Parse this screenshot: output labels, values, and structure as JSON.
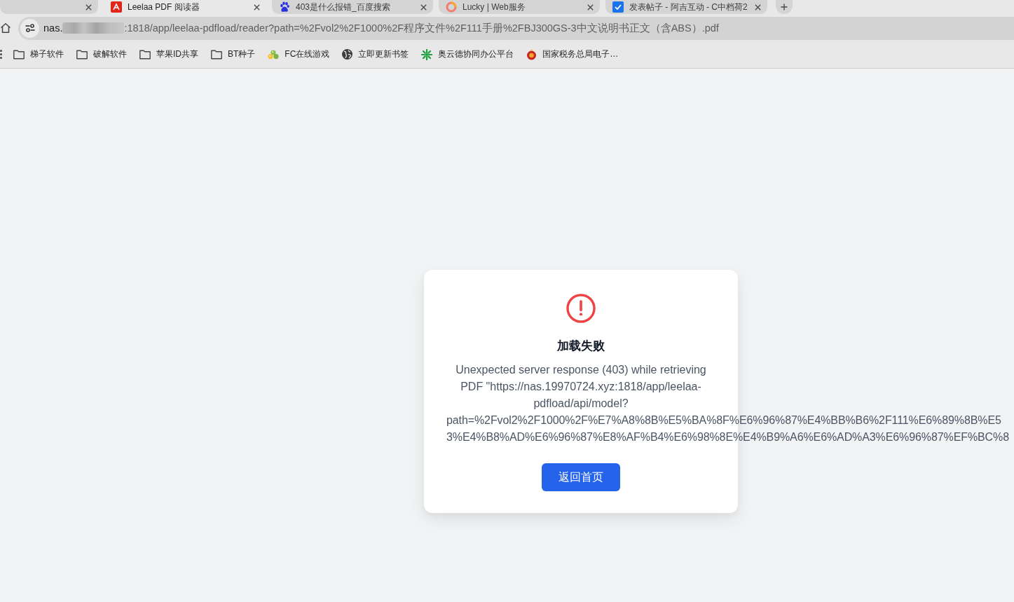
{
  "tabs": [
    {
      "selected": false
    },
    {
      "title": "Leelaa PDF 阅读器",
      "selected": true
    },
    {
      "title": "403是什么报错_百度搜索",
      "selected": false
    },
    {
      "title": "Lucky | Web服务",
      "selected": false
    },
    {
      "title": "发表帖子 - 阿吉互动 - C中档荷2",
      "selected": false
    }
  ],
  "address_bar": {
    "host_start": "nas.",
    "host_redacted": true,
    "url_rest": ":1818/app/leelaa-pdfload/reader?path=%2Fvol2%2F1000%2F程序文件%2F111手册%2FBJ300GS-3中文说明书正文（含ABS）.pdf"
  },
  "bookmarks": [
    {
      "label": "梯子软件",
      "kind": "folder"
    },
    {
      "label": "破解软件",
      "kind": "folder"
    },
    {
      "label": "苹果ID共享",
      "kind": "folder"
    },
    {
      "label": "BT种子",
      "kind": "folder"
    },
    {
      "label": "FC在线游戏",
      "kind": "blobs"
    },
    {
      "label": "立即更新书签",
      "kind": "globe"
    },
    {
      "label": "奥云德协同办公平台",
      "kind": "burst"
    },
    {
      "label": "国家税务总局电子…",
      "kind": "emblem"
    }
  ],
  "error_card": {
    "title": "加载失败",
    "message": "Unexpected server response (403) while retrieving PDF \"https://nas.19970724.xyz:1818/app/leelaa-pdfload/api/model?",
    "message_overflow_lines": [
      "path=%2Fvol2%2F1000%2F%E7%A8%8B%E5%BA%8F%E6%96%87%E4%BB%B6%2F111%E6%89%8B%E5",
      "3%E4%B8%AD%E6%96%87%E8%AF%B4%E6%98%8E%E4%B9%A6%E6%AD%A3%E6%96%87%EF%BC%8"
    ],
    "button": "返回首页"
  }
}
